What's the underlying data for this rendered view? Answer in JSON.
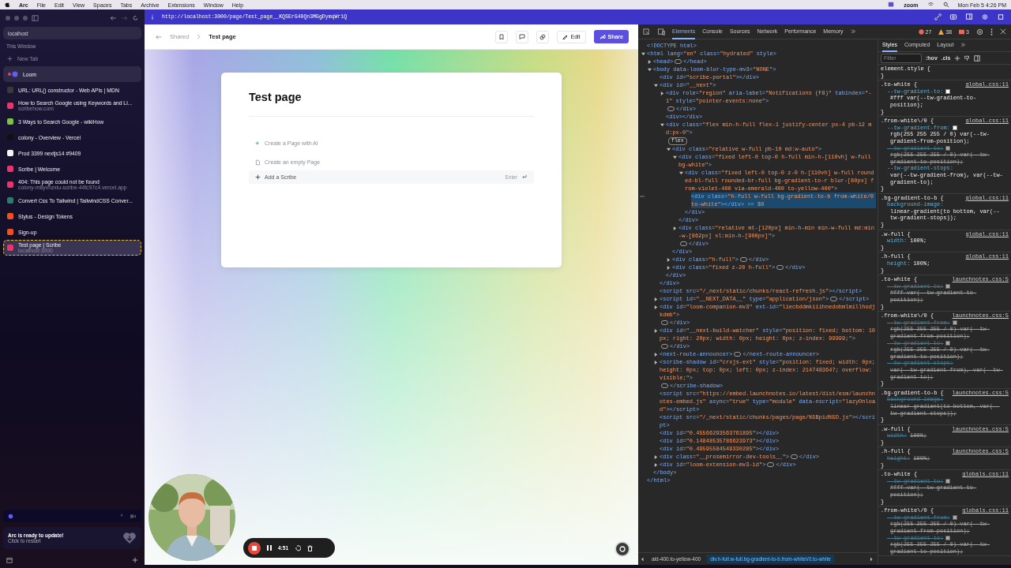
{
  "menu_bar": {
    "app": "Arc",
    "items": [
      "File",
      "Edit",
      "View",
      "Spaces",
      "Tabs",
      "Archive",
      "Extensions",
      "Window",
      "Help"
    ],
    "zoom_label": "zoom",
    "clock": "Mon Feb 5  4:26 PM"
  },
  "sidebar": {
    "search": "localhost",
    "section": "This Window",
    "new_tab": "New Tab",
    "pinned": {
      "label": "Loom"
    },
    "tabs": [
      {
        "title": "URL: URL() constructor - Web APIs | MDN",
        "color": "#3a3a3a",
        "selected": false
      },
      {
        "title": "How to Search Google using Keywords and Li...",
        "subtitle": "scribehow.com",
        "color": "#e8356d",
        "selected": false
      },
      {
        "title": "3 Ways to Search Google - wikiHow",
        "color": "#7cc243",
        "selected": false
      },
      {
        "title": "colony - Overview - Vercel",
        "color": "#111111",
        "selected": false
      },
      {
        "title": "Prod 3399 nextjs14 #9409",
        "color": "#f5f5f5",
        "selected": false
      },
      {
        "title": "Scribe | Welcome",
        "color": "#e8356d",
        "selected": false
      },
      {
        "title": "404: This page could not be found",
        "subtitle": "colony-m8yvhzxiu-scribe-44fc97c4.vercel.app",
        "color": "#e8356d",
        "selected": false
      },
      {
        "title": "Convert Css To Tailwind | TailwindCSS Conver...",
        "color": "#2b7a6b",
        "selected": false
      },
      {
        "title": "Stylus - Design Tokens",
        "color": "#f24e1e",
        "selected": false
      },
      {
        "title": "Sign-up",
        "color": "#f24e1e",
        "selected": false
      },
      {
        "title": "Test page | Scribe",
        "subtitle": "localhost:3000",
        "color": "#e8356d",
        "selected": true
      }
    ],
    "update": {
      "title": "Arc is ready to update!",
      "subtitle": "Click to restart"
    }
  },
  "url": "http://localhost:3000/page/Test_page__KQSErG40Qn3MGgDymqWr1Q",
  "page": {
    "breadcrumb": [
      "Shared",
      "Test page"
    ],
    "edit_label": "Edit",
    "share_label": "Share",
    "title": "Test page",
    "actions": [
      {
        "kind": "ai",
        "label": "Create a Page with AI"
      },
      {
        "kind": "empty",
        "label": "Create an empty Page"
      },
      {
        "kind": "scribe",
        "label": "Add a Scribe",
        "shortcut": "Enter"
      }
    ]
  },
  "recording": {
    "timer": "4:51"
  },
  "devtools": {
    "tabs": [
      {
        "label": "Elements",
        "selected": true
      },
      {
        "label": "Console",
        "selected": false
      },
      {
        "label": "Sources",
        "selected": false
      },
      {
        "label": "Network",
        "selected": false
      },
      {
        "label": "Performance",
        "selected": false
      },
      {
        "label": "Memory",
        "selected": false
      }
    ],
    "errors": "27",
    "warnings": "38",
    "messages": "3",
    "tree": [
      {
        "text": "<!DOCTYPE html>",
        "selected": false
      },
      {
        "text": "<html lang=\"en\" class=\"hydrated\" style>",
        "close": "</html>",
        "expanded": true,
        "selected": false,
        "children": [
          {
            "text": "<head>",
            "close": "</head>",
            "expanded": false,
            "selected": false
          },
          {
            "text": "<body data-loom-blur-type-mv3=\"NONE\">",
            "close": "</body>",
            "expanded": true,
            "selected": false,
            "children": [
              {
                "text": "<div id=\"scribe-portal\"></div>",
                "selected": false
              },
              {
                "text": "<div id=\"__next\">",
                "close": "</div>",
                "expanded": true,
                "selected": false,
                "children": [
                  {
                    "text": "<div role=\"region\" aria-label=\"Notifications (F8)\" tabindex=\"-1\" style=\"pointer-events:none\">",
                    "close": "</div>",
                    "expanded": false,
                    "selected": false
                  },
                  {
                    "text": "<div></div>",
                    "selected": false
                  },
                  {
                    "text": "<div class=\"flex min-h-full flex-1 justify-center px-4 pb-12 md:px-0\">",
                    "badge": "flex",
                    "close": "</div>",
                    "expanded": true,
                    "selected": false,
                    "children": [
                      {
                        "text": "<div class=\"relative w-full pb-10 md:w-auto\">",
                        "close": "</div>",
                        "expanded": true,
                        "selected": false,
                        "children": [
                          {
                            "text": "<div class=\"fixed left-0 top-0 h-full min-h-[110vh] w-full bg-white\">",
                            "close": "</div>",
                            "expanded": true,
                            "selected": false,
                            "children": [
                              {
                                "text": "<div class=\"fixed left-0 top-0 z-0 h-[110vh] w-full rounded-bl-full rounded-br-full bg-gradient-to-r blur-[80px] from-violet-400 via-emerald-400 to-yellow-400\">",
                                "close": "</div>",
                                "expanded": true,
                                "selected": false,
                                "children": [
                                  {
                                    "text": "<div class=\"h-full w-full bg-gradient-to-b from-white/0 to-white\"></div>",
                                    "suffix": "== $0",
                                    "selected": true
                                  }
                                ]
                              }
                            ]
                          },
                          {
                            "text": "<div class=\"relative mt-[120px] min-h-min min-w-full md:min-w-[862px] xl:min-h-[900px]\">",
                            "close": "</div>",
                            "expanded": false,
                            "selected": false
                          }
                        ]
                      },
                      {
                        "text": "<div class=\"h-full\">",
                        "close": "</div>",
                        "expanded": false,
                        "selected": false
                      },
                      {
                        "text": "<div class=\"fixed z-20 h-full\">",
                        "close": "</div>",
                        "expanded": false,
                        "selected": false
                      }
                    ]
                  }
                ]
              },
              {
                "text": "<script src=\"/_next/static/chunks/react-refresh.js\"></script>",
                "selected": false
              },
              {
                "text": "<script id=\"__NEXT_DATA__\" type=\"application/json\">",
                "close": "</script>",
                "expanded": false,
                "selected": false
              },
              {
                "text": "<div id=\"loom-companion-mv3\" ext-id=\"liecbddmkiiihnedobmlmillhodjkdmb\">",
                "close": "</div>",
                "expanded": false,
                "selected": false
              },
              {
                "text": "<div id=\"__next-build-watcher\" style=\"position: fixed; bottom: 10px; right: 20px; width: 0px; height: 0px; z-index: 99999;\">",
                "close": "</div>",
                "expanded": false,
                "selected": false
              },
              {
                "text": "<next-route-announcer>",
                "close": "</next-route-announcer>",
                "expanded": false,
                "selected": false
              },
              {
                "text": "<scribe-shadow id=\"crxjs-ext\" style=\"position: fixed; width: 0px; height: 0px; top: 0px; left: 0px; z-index: 2147483647; overflow: visible;\">",
                "close": "</scribe-shadow>",
                "expanded": false,
                "selected": false
              },
              {
                "text": "<script src=\"https://embed.launchnotes.io/latest/dist/esm/launchnotes-embed.js\" async=\"true\" type=\"module\" data-nscript=\"lazyOnload\"></script>",
                "selected": false
              },
              {
                "text": "<script src=\"/_next/static/chunks/pages/page/%5Bpid%5D.js\"></script>",
                "selected": false
              },
              {
                "text": "<div id=\"0.45566293563761895\"></div>",
                "selected": false
              },
              {
                "text": "<div id=\"0.14848535786623973\"></div>",
                "selected": false
              },
              {
                "text": "<div id=\"0.49595584549330285\"></div>",
                "selected": false
              },
              {
                "text": "<div class=\"__prosemirror-dev-tools__\">",
                "close": "</div>",
                "expanded": false,
                "selected": false
              },
              {
                "text": "<div id=\"loom-extension-mv3-id\">",
                "close": "</div>",
                "expanded": false,
                "selected": false
              }
            ]
          }
        ]
      }
    ],
    "crumbs": [
      {
        "label": "ald-400.to-yellow-400",
        "selected": false
      },
      {
        "label": "div.h-full.w-full.bg-gradient-to-b.from-white\\/0.to-white",
        "selected": true
      }
    ],
    "styles": {
      "tabs": [
        {
          "label": "Styles",
          "selected": true
        },
        {
          "label": "Computed",
          "selected": false
        },
        {
          "label": "Layout",
          "selected": false
        }
      ],
      "filter_placeholder": "Filter",
      "hov": ":hov",
      "cls": ".cls",
      "rules": [
        {
          "selector": "element.style {",
          "close": "}"
        },
        {
          "selector": ".to-white {",
          "source": "global.css:11",
          "close": "}",
          "props": [
            {
              "name": "--tw-gradient-to:",
              "value": "#fff var(--tw-gradient-to-position);",
              "swatch": true,
              "struck": false
            }
          ]
        },
        {
          "selector": ".from-white\\/0 {",
          "source": "global.css:11",
          "close": "}",
          "props": [
            {
              "name": "--tw-gradient-from:",
              "value": "rgb(255 255 255 / 0) var(--tw-gradient-from-position);",
              "swatch": true,
              "struck": false
            },
            {
              "name": "--tw-gradient-to:",
              "value": "rgb(255 255 255 / 0) var(--tw-gradient-to-position);",
              "swatch": true,
              "struck": true
            },
            {
              "name": "--tw-gradient-stops:",
              "value": "var(--tw-gradient-from), var(--tw-gradient-to);",
              "struck": false
            }
          ]
        },
        {
          "selector": ".bg-gradient-to-b {",
          "source": "global.css:11",
          "close": "}",
          "props": [
            {
              "name": "background-image:",
              "value": "linear-gradient(to bottom, var(--tw-gradient-stops));",
              "struck": false
            }
          ]
        },
        {
          "selector": ".w-full {",
          "source": "global.css:11",
          "close": "}",
          "props": [
            {
              "name": "width:",
              "value": "100%;",
              "struck": false
            }
          ]
        },
        {
          "selector": ".h-full {",
          "source": "global.css:11",
          "close": "}",
          "props": [
            {
              "name": "height:",
              "value": "100%;",
              "struck": false
            }
          ]
        },
        {
          "selector": ".to-white {",
          "source": "launchnotes.css:5",
          "close": "}",
          "props": [
            {
              "name": "--tw-gradient-to:",
              "value": "#fff var(--tw-gradient-to-position);",
              "swatch": true,
              "struck": true
            }
          ]
        },
        {
          "selector": ".from-white\\/0 {",
          "source": "launchnotes.css:5",
          "close": "}",
          "props": [
            {
              "name": "--tw-gradient-from:",
              "value": "rgb(255 255 255 / 0) var(--tw-gradient-from-position);",
              "swatch": true,
              "struck": true
            },
            {
              "name": "--tw-gradient-to:",
              "value": "rgb(255 255 255 / 0) var(--tw-gradient-to-position);",
              "swatch": true,
              "struck": true
            },
            {
              "name": "--tw-gradient-stops:",
              "value": "var(--tw-gradient-from), var(--tw-gradient-to);",
              "struck": true
            }
          ]
        },
        {
          "selector": ".bg-gradient-to-b {",
          "source": "launchnotes.css:5",
          "close": "}",
          "props": [
            {
              "name": "background-image:",
              "value": "linear-gradient(to bottom, var(--tw-gradient-stops));",
              "struck": true
            }
          ]
        },
        {
          "selector": ".w-full {",
          "source": "launchnotes.css:5",
          "close": "}",
          "props": [
            {
              "name": "width:",
              "value": "100%;",
              "struck": true
            }
          ]
        },
        {
          "selector": ".h-full {",
          "source": "launchnotes.css:5",
          "close": "}",
          "props": [
            {
              "name": "height:",
              "value": "100%;",
              "struck": true
            }
          ]
        },
        {
          "selector": ".to-white {",
          "source": "globals.css:11",
          "close": "}",
          "props": [
            {
              "name": "--tw-gradient-to:",
              "value": "#fff var(--tw-gradient-to-position);",
              "swatch": true,
              "struck": true
            }
          ]
        },
        {
          "selector": ".from-white\\/0 {",
          "source": "globals.css:11",
          "props": [
            {
              "name": "--tw-gradient-from:",
              "value": "rgb(255 255 255 / 0) var(--tw-gradient-from-position);",
              "swatch": true,
              "struck": true
            },
            {
              "name": "--tw-gradient-to:",
              "value": "rgb(255 255 255 / 0) var(--tw-gradient-to-position);",
              "swatch": true,
              "struck": true
            }
          ]
        }
      ]
    }
  }
}
